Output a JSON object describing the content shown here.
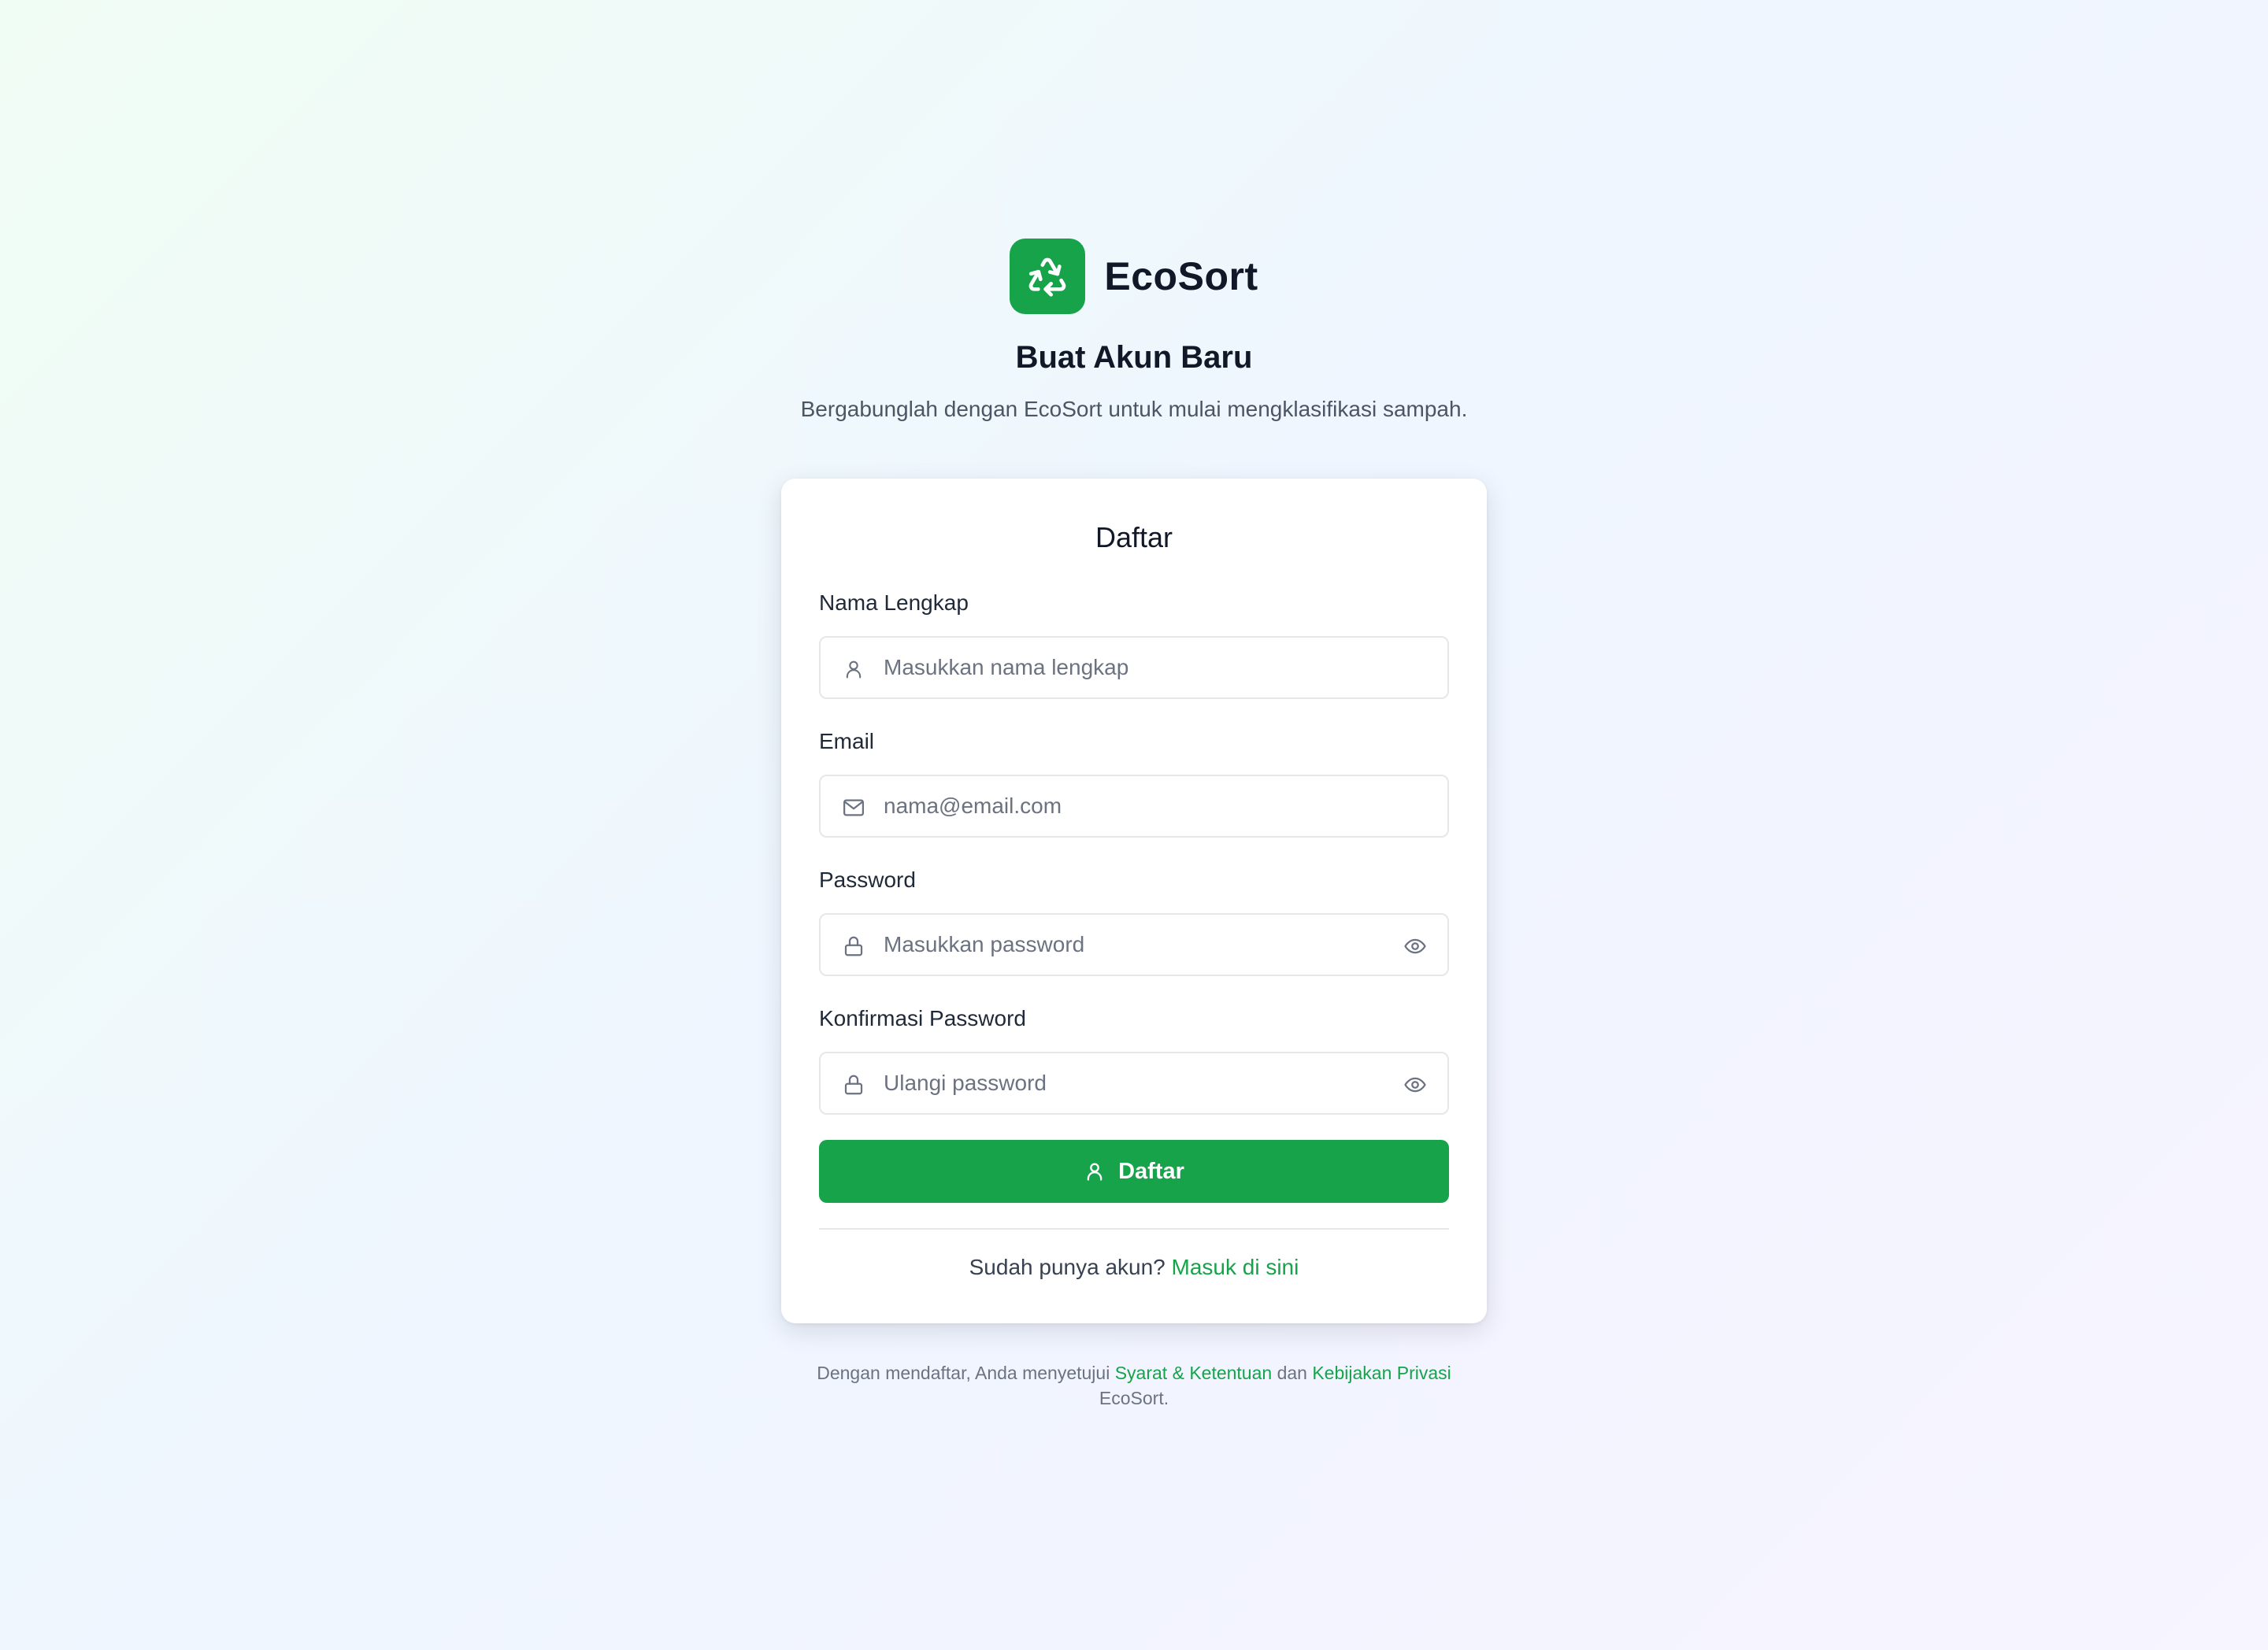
{
  "brand": {
    "name": "EcoSort",
    "logo_icon": "recycle-icon"
  },
  "heading": "Buat Akun Baru",
  "subheading": "Bergabunglah dengan EcoSort untuk mulai mengklasifikasi sampah.",
  "card": {
    "title": "Daftar",
    "fields": {
      "name": {
        "label": "Nama Lengkap",
        "placeholder": "Masukkan nama lengkap",
        "value": "",
        "icon": "user-icon"
      },
      "email": {
        "label": "Email",
        "placeholder": "nama@email.com",
        "value": "",
        "icon": "mail-icon"
      },
      "password": {
        "label": "Password",
        "placeholder": "Masukkan password",
        "value": "",
        "icon": "lock-icon",
        "toggle_icon": "eye-icon"
      },
      "confirm": {
        "label": "Konfirmasi Password",
        "placeholder": "Ulangi password",
        "value": "",
        "icon": "lock-icon",
        "toggle_icon": "eye-icon"
      }
    },
    "submit_label": "Daftar",
    "submit_icon": "user-icon",
    "login_prompt": "Sudah punya akun?",
    "login_link": "Masuk di sini"
  },
  "footer": {
    "text_before": "Dengan mendaftar, Anda menyetujui",
    "terms_link": "Syarat & Ketentuan",
    "conjunction": "dan",
    "privacy_link": "Kebijakan Privasi",
    "text_after": "EcoSort."
  },
  "colors": {
    "accent": "#16a34a",
    "text_primary": "#111827",
    "text_muted": "#6b7280",
    "border": "#e5e7eb"
  }
}
